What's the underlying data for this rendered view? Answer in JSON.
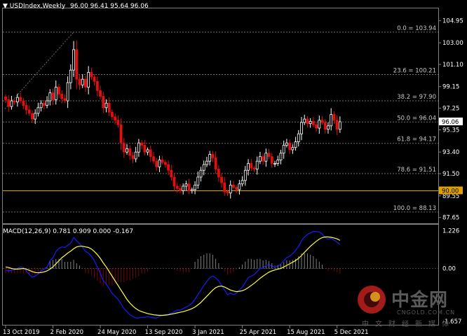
{
  "header": {
    "symbol": "USDIndex,Weekly",
    "ohlc": "96.00 96.41 95.64 96.06"
  },
  "macd_header": "MACD(12,26,9) 0.781 0.909 0.000 -0.167",
  "watermark": {
    "title": "中金网",
    "url": "CNGOLD.COM.CN",
    "subtitle": "中文财经新媒体"
  },
  "colors": {
    "background": "#000000",
    "grid": "#6c6c6c",
    "bull": "#ffffff",
    "bear": "#e01010",
    "price_label_bg": "#ffffff",
    "level_90": "#e0a000",
    "macd_line": "#1a1aff",
    "signal_line": "#ffff40"
  },
  "chart_data": [
    {
      "type": "candlestick",
      "yticks": [
        "104.95",
        "103.00",
        "101.10",
        "99.15",
        "97.25",
        "95.35",
        "93.40",
        "91.50",
        "89.55",
        "87.65"
      ],
      "ytick_values": [
        104.95,
        103.0,
        101.1,
        99.15,
        97.25,
        95.35,
        93.4,
        91.5,
        89.55,
        87.65
      ],
      "ylim": [
        87.2,
        105.9
      ],
      "xticks": [
        {
          "label": "13 Oct 2019",
          "index": 0
        },
        {
          "label": "2 Feb 2020",
          "index": 16
        },
        {
          "label": "24 May 2020",
          "index": 32
        },
        {
          "label": "13 Sep 2020",
          "index": 48
        },
        {
          "label": "3 Jan 2021",
          "index": 64
        },
        {
          "label": "25 Apr 2021",
          "index": 80
        },
        {
          "label": "15 Aug 2021",
          "index": 96
        },
        {
          "label": "5 Dec 2021",
          "index": 112
        }
      ],
      "fib_levels": [
        {
          "label": "0.0 = 103.94",
          "value": 103.94
        },
        {
          "label": "23.6 = 100.21",
          "value": 100.21
        },
        {
          "label": "38.2 = 97.90",
          "value": 97.9
        },
        {
          "label": "50.0 = 96.04",
          "value": 96.04
        },
        {
          "label": "61.8 = 94.17",
          "value": 94.17
        },
        {
          "label": "78.6 = 91.51",
          "value": 91.51
        },
        {
          "label": "100.0 = 88.13",
          "value": 88.13
        }
      ],
      "current_price": {
        "label": "96.06",
        "value": 96.06
      },
      "level_line": {
        "label": "90.00",
        "value": 90.0
      },
      "close": [
        98.0,
        97.4,
        97.9,
        97.8,
        98.2,
        97.9,
        97.5,
        97.1,
        96.8,
        96.3,
        96.8,
        97.3,
        97.7,
        97.5,
        97.9,
        98.6,
        98.0,
        99.1,
        98.5,
        98.1,
        97.9,
        99.5,
        100.6,
        102.4,
        99.8,
        99.3,
        99.8,
        99.1,
        100.4,
        100.0,
        99.6,
        98.8,
        98.3,
        97.3,
        97.7,
        96.9,
        96.5,
        96.2,
        95.8,
        94.2,
        93.4,
        93.7,
        93.1,
        92.8,
        93.4,
        94.2,
        94.0,
        93.4,
        93.6,
        93.0,
        92.6,
        92.1,
        92.7,
        92.5,
        92.3,
        91.8,
        91.2,
        90.4,
        90.2,
        90.0,
        90.4,
        90.6,
        90.0,
        90.1,
        90.5,
        91.2,
        91.8,
        92.3,
        92.6,
        93.2,
        92.9,
        91.9,
        91.2,
        90.7,
        89.9,
        89.8,
        90.5,
        90.3,
        90.1,
        90.6,
        90.9,
        91.8,
        92.4,
        92.0,
        91.9,
        92.6,
        93.0,
        92.6,
        93.3,
        93.0,
        92.4,
        92.4,
        92.7,
        93.3,
        94.0,
        94.2,
        93.6,
        93.8,
        94.3,
        95.0,
        96.0,
        96.3,
        95.9,
        96.1,
        95.8,
        95.5,
        96.2,
        96.0,
        95.4,
        95.7,
        96.7,
        96.2,
        95.4,
        96.06
      ],
      "macd_panel": {
        "label_top": "1.226",
        "label_zero": "0.00",
        "label_bottom": "-1.657",
        "ylim": [
          -1.78,
          1.35
        ],
        "macd": [
          -0.05,
          -0.08,
          -0.06,
          -0.05,
          0.0,
          0.05,
          0.03,
          -0.08,
          -0.2,
          -0.28,
          -0.25,
          -0.18,
          -0.08,
          -0.02,
          0.05,
          0.25,
          0.35,
          0.55,
          0.65,
          0.7,
          0.68,
          0.75,
          0.82,
          1.0,
          0.9,
          0.8,
          0.7,
          0.55,
          0.5,
          0.4,
          0.25,
          0.05,
          -0.15,
          -0.4,
          -0.5,
          -0.65,
          -0.8,
          -0.9,
          -1.0,
          -1.15,
          -1.3,
          -1.4,
          -1.5,
          -1.55,
          -1.6,
          -1.6,
          -1.58,
          -1.58,
          -1.56,
          -1.58,
          -1.6,
          -1.6,
          -1.55,
          -1.52,
          -1.5,
          -1.48,
          -1.45,
          -1.4,
          -1.35,
          -1.35,
          -1.3,
          -1.25,
          -1.2,
          -1.12,
          -1.0,
          -0.85,
          -0.7,
          -0.55,
          -0.42,
          -0.3,
          -0.25,
          -0.3,
          -0.4,
          -0.55,
          -0.7,
          -0.85,
          -0.8,
          -0.85,
          -0.8,
          -0.7,
          -0.6,
          -0.45,
          -0.3,
          -0.25,
          -0.2,
          -0.1,
          0.0,
          0.02,
          0.1,
          0.12,
          0.08,
          0.05,
          0.08,
          0.15,
          0.25,
          0.35,
          0.4,
          0.48,
          0.58,
          0.72,
          0.9,
          1.02,
          1.1,
          1.15,
          1.2,
          1.2,
          1.18,
          1.12,
          1.0,
          0.95,
          0.98,
          0.92,
          0.85,
          0.781
        ],
        "signal": [
          0.05,
          0.03,
          0.0,
          -0.02,
          -0.02,
          -0.01,
          0.0,
          -0.02,
          -0.06,
          -0.1,
          -0.13,
          -0.14,
          -0.13,
          -0.11,
          -0.08,
          -0.02,
          0.05,
          0.15,
          0.25,
          0.35,
          0.42,
          0.5,
          0.56,
          0.64,
          0.7,
          0.72,
          0.72,
          0.7,
          0.68,
          0.63,
          0.55,
          0.45,
          0.33,
          0.18,
          0.05,
          -0.1,
          -0.25,
          -0.4,
          -0.55,
          -0.7,
          -0.85,
          -1.0,
          -1.12,
          -1.22,
          -1.3,
          -1.36,
          -1.4,
          -1.43,
          -1.46,
          -1.48,
          -1.5,
          -1.51,
          -1.52,
          -1.52,
          -1.51,
          -1.5,
          -1.48,
          -1.46,
          -1.44,
          -1.42,
          -1.4,
          -1.37,
          -1.34,
          -1.3,
          -1.25,
          -1.18,
          -1.1,
          -1.0,
          -0.9,
          -0.8,
          -0.7,
          -0.62,
          -0.58,
          -0.57,
          -0.6,
          -0.65,
          -0.7,
          -0.73,
          -0.75,
          -0.74,
          -0.72,
          -0.68,
          -0.62,
          -0.55,
          -0.48,
          -0.4,
          -0.32,
          -0.25,
          -0.18,
          -0.12,
          -0.08,
          -0.05,
          -0.02,
          0.0,
          0.05,
          0.1,
          0.15,
          0.2,
          0.26,
          0.33,
          0.42,
          0.52,
          0.62,
          0.72,
          0.8,
          0.88,
          0.95,
          1.0,
          1.02,
          1.02,
          1.01,
          0.99,
          0.96,
          0.909
        ],
        "hist": [
          -0.15,
          -0.15,
          -0.15,
          -0.15,
          -0.15,
          -0.15,
          -0.15,
          -0.15,
          -0.2,
          -0.22,
          -0.2,
          -0.15,
          -0.12,
          -0.05,
          0.02,
          0.25,
          0.28,
          0.3,
          0.32,
          0.3,
          0.22,
          0.22,
          0.22,
          0.28,
          0.18,
          0.1,
          0.0,
          -0.15,
          -0.18,
          -0.22,
          -0.3,
          -0.4,
          -0.48,
          -0.58,
          -0.55,
          -0.55,
          -0.55,
          -0.5,
          -0.45,
          -0.45,
          -0.45,
          -0.4,
          -0.38,
          -0.33,
          -0.3,
          -0.24,
          -0.18,
          -0.15,
          -0.1,
          0.0,
          0.0,
          0.0,
          0.0,
          0.0,
          0.0,
          0.0,
          0.0,
          -0.05,
          -0.08,
          -0.1,
          -0.12,
          -0.12,
          -0.12,
          0.0,
          0.22,
          0.3,
          0.4,
          0.45,
          0.48,
          0.5,
          0.45,
          0.32,
          0.18,
          0.02,
          -0.1,
          -0.2,
          -0.15,
          -0.12,
          -0.05,
          0.05,
          0.12,
          0.23,
          0.32,
          0.3,
          0.28,
          0.3,
          0.32,
          0.27,
          0.28,
          0.24,
          0.16,
          0.1,
          0.1,
          0.15,
          0.2,
          0.25,
          0.25,
          0.28,
          0.32,
          0.39,
          0.48,
          0.5,
          0.48,
          0.43,
          0.4,
          0.32,
          0.23,
          0.12,
          0.0,
          -0.07,
          -0.03,
          -0.07,
          -0.11,
          -0.167
        ]
      }
    }
  ]
}
